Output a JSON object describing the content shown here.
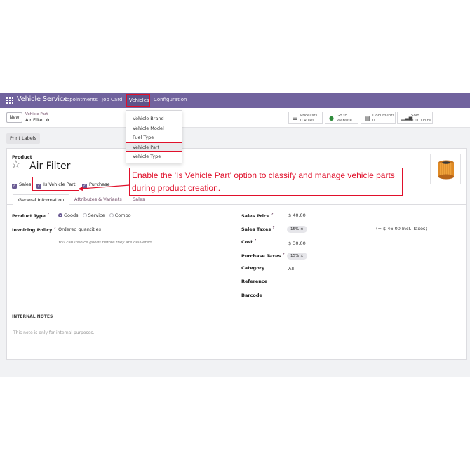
{
  "navbar": {
    "app_name": "Vehicle Service",
    "menu": [
      "Appointments",
      "Job Card",
      "Vehicles",
      "Configuration"
    ]
  },
  "vehicles_menu": [
    "Vehicle Brand",
    "Vehicle Model",
    "Fuel Type",
    "Vehicle Part",
    "Vehicle Type"
  ],
  "control_panel": {
    "new_label": "New",
    "breadcrumb_parent": "Vehicle Part",
    "breadcrumb_current": "Air Filter",
    "smart_buttons": [
      {
        "icon": "list-icon",
        "line1": "Pricelists",
        "line2": "0 Rules"
      },
      {
        "icon": "globe-icon",
        "line1": "Go to",
        "line2": "Website"
      },
      {
        "icon": "document-icon",
        "line1": "Documents",
        "line2": "0"
      },
      {
        "icon": "chart-icon",
        "line1": "Sold",
        "line2": "0.00 Units"
      }
    ]
  },
  "print_labels": "Print Labels",
  "form": {
    "product_label": "Product",
    "product_name": "Air Filter",
    "checkboxes": [
      "Sales",
      "Is Vehicle Part",
      "Purchase"
    ],
    "callout_text": "Enable the 'Is Vehicle Part' option to classify and manage vehicle parts during product creation.",
    "tabs": [
      "General Information",
      "Attributes & Variants",
      "Sales"
    ],
    "product_type_label": "Product Type",
    "product_type_options": [
      "Goods",
      "Service",
      "Combo"
    ],
    "invoicing_policy_label": "Invoicing Policy",
    "invoicing_policy_value": "Ordered quantities",
    "invoicing_note": "You can invoice goods before they are delivered.",
    "sales_price_label": "Sales Price",
    "sales_price_value": "$ 40.00",
    "sales_taxes_label": "Sales Taxes",
    "sales_taxes_tag": "15% ×",
    "sales_taxes_incl": "(= $ 46.00 Incl. Taxes)",
    "cost_label": "Cost",
    "cost_value": "$ 30.00",
    "purchase_taxes_label": "Purchase Taxes",
    "purchase_taxes_tag": "15% ×",
    "category_label": "Category",
    "category_value": "All",
    "reference_label": "Reference",
    "barcode_label": "Barcode",
    "internal_notes_label": "INTERNAL NOTES",
    "internal_notes_placeholder": "This note is only for internal purposes."
  },
  "colors": {
    "navbar": "#71639e",
    "highlight": "#e0102b",
    "accent": "#714b67"
  }
}
